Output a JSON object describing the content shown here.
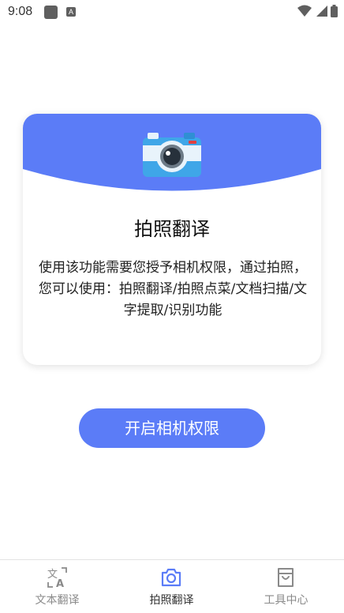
{
  "status_bar": {
    "time": "9:08",
    "icons": [
      "app-notification-icon",
      "a-notification-icon",
      "wifi-icon",
      "signal-icon",
      "battery-icon"
    ]
  },
  "card": {
    "title": "拍照翻译",
    "description": "使用该功能需要您授予相机权限，通过拍照，您可以使用：拍照翻译/拍照点菜/文档扫描/文字提取/识别功能",
    "icon": "camera-icon",
    "accent_color": "#5b7cf7"
  },
  "enable_button": {
    "label": "开启相机权限"
  },
  "bottom_nav": {
    "items": [
      {
        "label": "文本翻译",
        "icon": "text-translate-icon",
        "active": false
      },
      {
        "label": "拍照翻译",
        "icon": "camera-icon",
        "active": true
      },
      {
        "label": "工具中心",
        "icon": "shopping-bag-icon",
        "active": false
      }
    ],
    "active_color": "#5b7cf7"
  }
}
